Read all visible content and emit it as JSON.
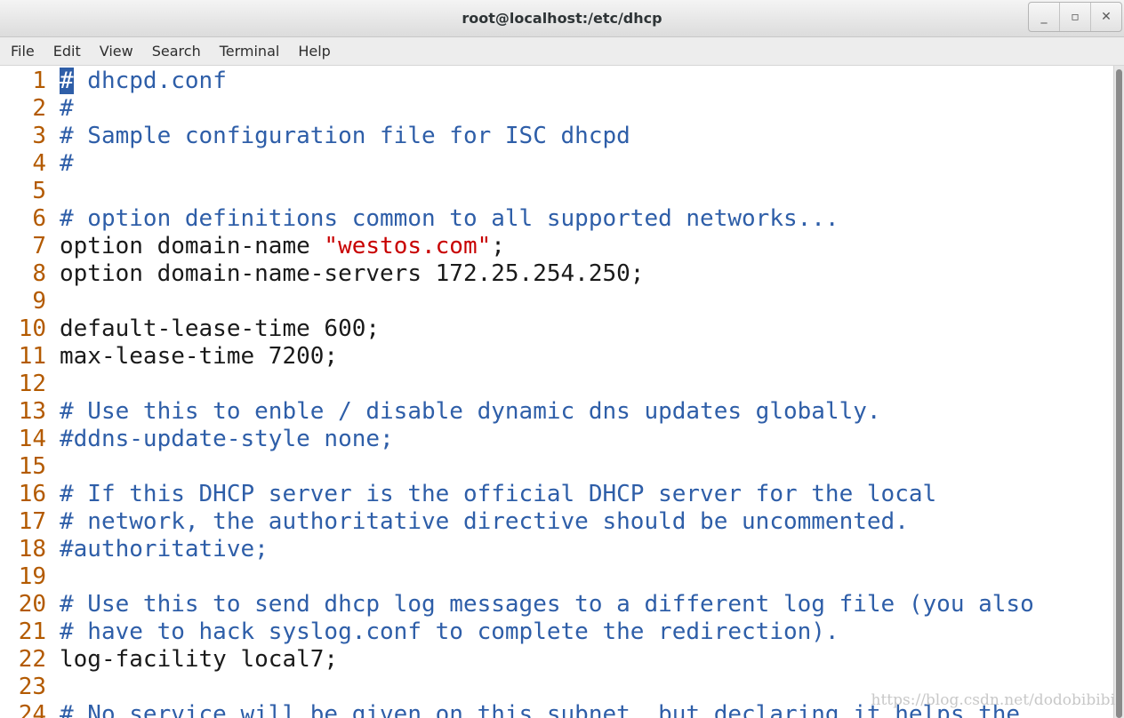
{
  "window": {
    "title": "root@localhost:/etc/dhcp",
    "controls": [
      "_",
      "▫",
      "✕"
    ]
  },
  "menu": [
    "File",
    "Edit",
    "View",
    "Search",
    "Terminal",
    "Help"
  ],
  "editor": {
    "lines": [
      {
        "n": "1",
        "segments": [
          {
            "t": "#",
            "c": "cursor"
          },
          {
            "t": " dhcpd.conf",
            "c": "comment"
          }
        ]
      },
      {
        "n": "2",
        "segments": [
          {
            "t": "#",
            "c": "comment"
          }
        ]
      },
      {
        "n": "3",
        "segments": [
          {
            "t": "# Sample configuration file for ISC dhcpd",
            "c": "comment"
          }
        ]
      },
      {
        "n": "4",
        "segments": [
          {
            "t": "#",
            "c": "comment"
          }
        ]
      },
      {
        "n": "5",
        "segments": []
      },
      {
        "n": "6",
        "segments": [
          {
            "t": "# option definitions common to all supported networks...",
            "c": "comment"
          }
        ]
      },
      {
        "n": "7",
        "segments": [
          {
            "t": "option domain-name ",
            "c": "code"
          },
          {
            "t": "\"westos.com\"",
            "c": "str"
          },
          {
            "t": ";",
            "c": "code"
          }
        ]
      },
      {
        "n": "8",
        "segments": [
          {
            "t": "option domain-name-servers 172.25.254.250;",
            "c": "code"
          }
        ]
      },
      {
        "n": "9",
        "segments": []
      },
      {
        "n": "10",
        "segments": [
          {
            "t": "default-lease-time 600;",
            "c": "code"
          }
        ]
      },
      {
        "n": "11",
        "segments": [
          {
            "t": "max-lease-time 7200;",
            "c": "code"
          }
        ]
      },
      {
        "n": "12",
        "segments": []
      },
      {
        "n": "13",
        "segments": [
          {
            "t": "# Use this to enble / disable dynamic dns updates globally.",
            "c": "comment"
          }
        ]
      },
      {
        "n": "14",
        "segments": [
          {
            "t": "#ddns-update-style none;",
            "c": "comment"
          }
        ]
      },
      {
        "n": "15",
        "segments": []
      },
      {
        "n": "16",
        "segments": [
          {
            "t": "# If this DHCP server is the official DHCP server for the local",
            "c": "comment"
          }
        ]
      },
      {
        "n": "17",
        "segments": [
          {
            "t": "# network, the authoritative directive should be uncommented.",
            "c": "comment"
          }
        ]
      },
      {
        "n": "18",
        "segments": [
          {
            "t": "#authoritative;",
            "c": "comment"
          }
        ]
      },
      {
        "n": "19",
        "segments": []
      },
      {
        "n": "20",
        "segments": [
          {
            "t": "# Use this to send dhcp log messages to a different log file (you also",
            "c": "comment"
          }
        ]
      },
      {
        "n": "21",
        "segments": [
          {
            "t": "# have to hack syslog.conf to complete the redirection).",
            "c": "comment"
          }
        ]
      },
      {
        "n": "22",
        "segments": [
          {
            "t": "log-facility local7;",
            "c": "code"
          }
        ]
      },
      {
        "n": "23",
        "segments": []
      },
      {
        "n": "24",
        "segments": [
          {
            "t": "# No service will be given on this subnet, but declaring it helps the",
            "c": "comment"
          }
        ]
      }
    ]
  },
  "watermark": "https://blog.csdn.net/dodobibibi"
}
